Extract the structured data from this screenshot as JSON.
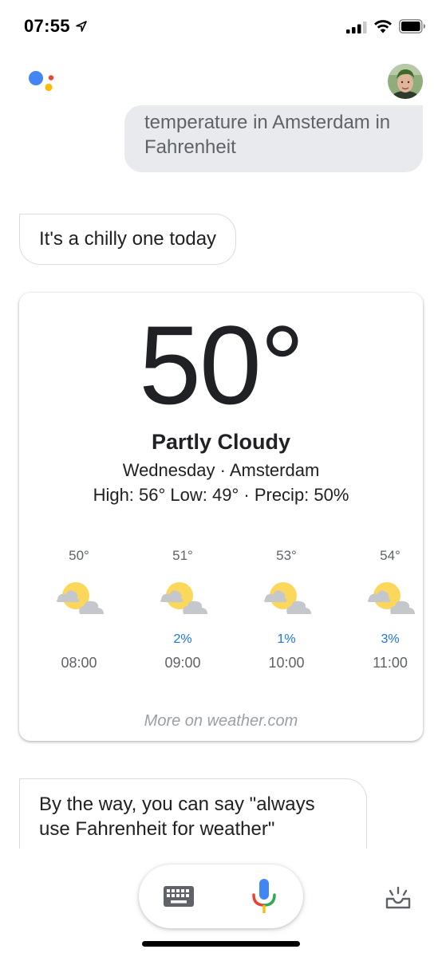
{
  "status_bar": {
    "time": "07:55"
  },
  "chat": {
    "user_query": "temperature in Amsterdam in Fahrenheit",
    "assistant_reply": "It's a chilly one today",
    "tip": "By the way, you can say \"always use Fahrenheit for weather\""
  },
  "weather": {
    "temperature": "50°",
    "condition": "Partly Cloudy",
    "day_city": "Wednesday · Amsterdam",
    "high_low_precip": "High: 56° Low: 49° · Precip: 50%",
    "hourly": [
      {
        "temp": "50°",
        "precip": "",
        "time": "08:00",
        "icon": "partly-cloudy-icon"
      },
      {
        "temp": "51°",
        "precip": "2%",
        "time": "09:00",
        "icon": "partly-cloudy-icon"
      },
      {
        "temp": "53°",
        "precip": "1%",
        "time": "10:00",
        "icon": "partly-cloudy-icon"
      },
      {
        "temp": "54°",
        "precip": "3%",
        "time": "11:00",
        "icon": "partly-cloudy-icon"
      }
    ],
    "more_link": "More on weather.com"
  },
  "colors": {
    "google_blue": "#4285F4",
    "google_red": "#EA4335",
    "google_yellow": "#FBBC05",
    "google_green": "#34A853",
    "precip_blue": "#1a73e8",
    "user_bubble_bg": "#e9eaed"
  },
  "icons": {
    "location": "location-arrow-icon",
    "signal": "cellular-signal-icon",
    "wifi": "wifi-icon",
    "battery": "battery-icon",
    "assistant": "google-assistant-logo",
    "keyboard": "keyboard-icon",
    "mic": "microphone-icon",
    "explore": "explore-tray-icon"
  }
}
